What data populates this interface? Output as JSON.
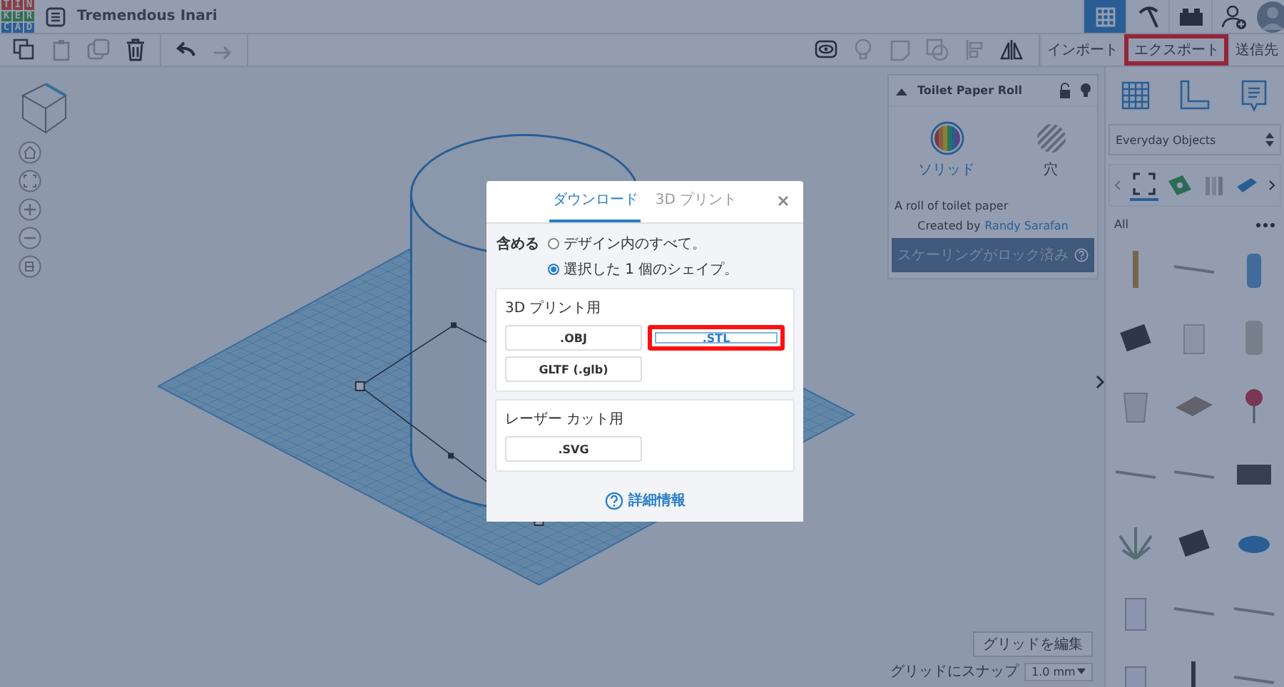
{
  "app": {
    "logo_letters": [
      "T",
      "I",
      "N",
      "K",
      "E",
      "R",
      "C",
      "A",
      "D"
    ],
    "title": "Tremendous Inari"
  },
  "export_bar": [
    {
      "label": "インポート",
      "highlighted": false
    },
    {
      "label": "エクスポート",
      "highlighted": true
    },
    {
      "label": "送信先",
      "highlighted": false
    }
  ],
  "inspector": {
    "title": "Toilet Paper Roll",
    "modes": [
      {
        "label": "ソリッド",
        "kind": "solid",
        "selected": true
      },
      {
        "label": "穴",
        "kind": "hole",
        "selected": false
      }
    ],
    "description": "A roll of toilet paper",
    "creator_prefix": "Created by",
    "creator": "Randy Sarafan",
    "scaling": "スケーリングがロック済み"
  },
  "library": {
    "category": "Everyday Objects",
    "filter": "All"
  },
  "grid": {
    "edit_button": "グリッドを編集",
    "snap_label": "グリッドにスナップ",
    "snap_value": "1.0 mm"
  },
  "dialog": {
    "tabs": [
      {
        "label": "ダウンロード",
        "selected": true
      },
      {
        "label": "3D プリント",
        "selected": false
      }
    ],
    "include_label": "含める",
    "options": [
      {
        "label": "デザイン内のすべて。",
        "selected": false
      },
      {
        "label": "選択した 1 個のシェイプ。",
        "selected": true
      }
    ],
    "sections": [
      {
        "title": "3D プリント用",
        "formats": [
          {
            "label": ".OBJ",
            "highlighted": false
          },
          {
            "label": ".STL",
            "highlighted": true
          },
          {
            "label": "GLTF (.glb)",
            "highlighted": false
          }
        ]
      },
      {
        "title": "レーザー カット用",
        "formats": [
          {
            "label": ".SVG",
            "highlighted": false
          }
        ]
      }
    ],
    "more_info": "詳細情報"
  }
}
